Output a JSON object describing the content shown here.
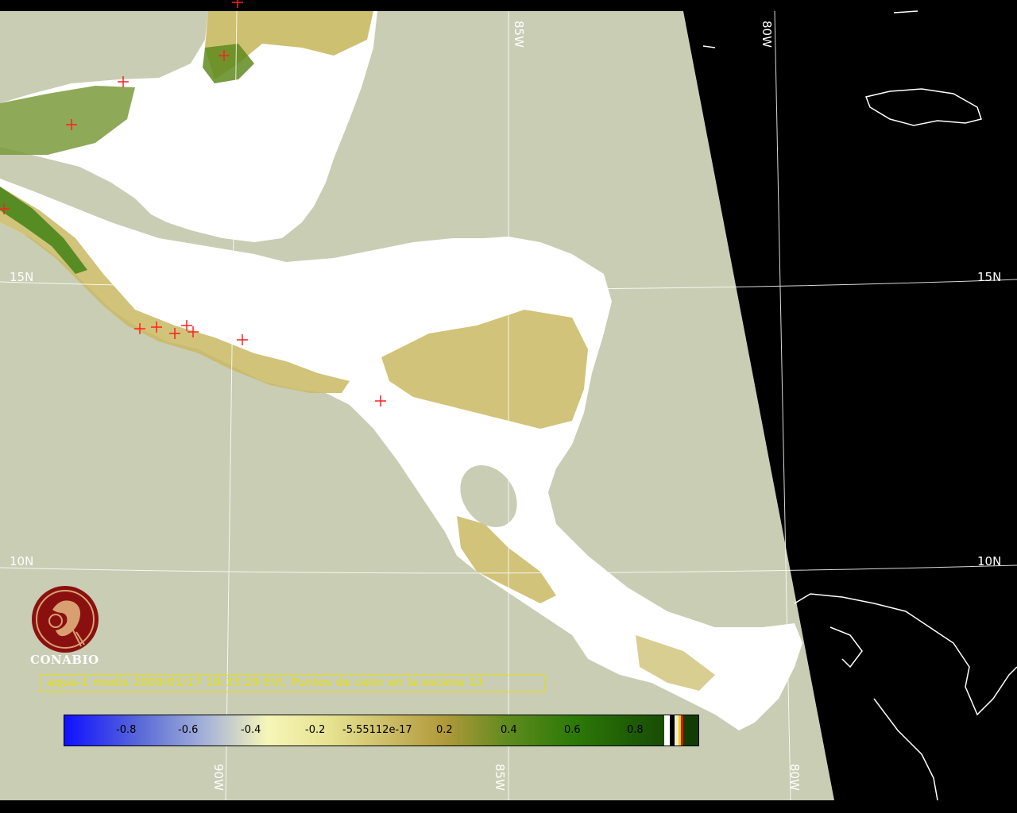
{
  "map": {
    "grid_labels": {
      "lon_top": [
        "85W",
        "80W"
      ],
      "lon_bottom": [
        "90W",
        "85W",
        "80W"
      ],
      "lat_left": [
        "15N",
        "10N"
      ],
      "lat_right": [
        "15N",
        "10N"
      ]
    },
    "colors": {
      "ocean": "#c8cdb4",
      "background": "#000000",
      "cloud": "#ffffff",
      "vegetation_low": "#c9b962",
      "vegetation_high": "#2e7a08",
      "hotspot_marker": "#ff2020",
      "gridline": "#ffffff"
    }
  },
  "logo": {
    "name": "CONABIO"
  },
  "caption": {
    "text": "aqua-1 modis 2009/01/17 19:33:29 EVI, Puntos de calor en la escena 13"
  },
  "colorbar": {
    "labels": [
      "-0.8",
      "-0.6",
      "-0.4",
      "-0.2",
      "-5.55112e-17",
      "0.2",
      "0.4",
      "0.6",
      "0.8"
    ]
  }
}
